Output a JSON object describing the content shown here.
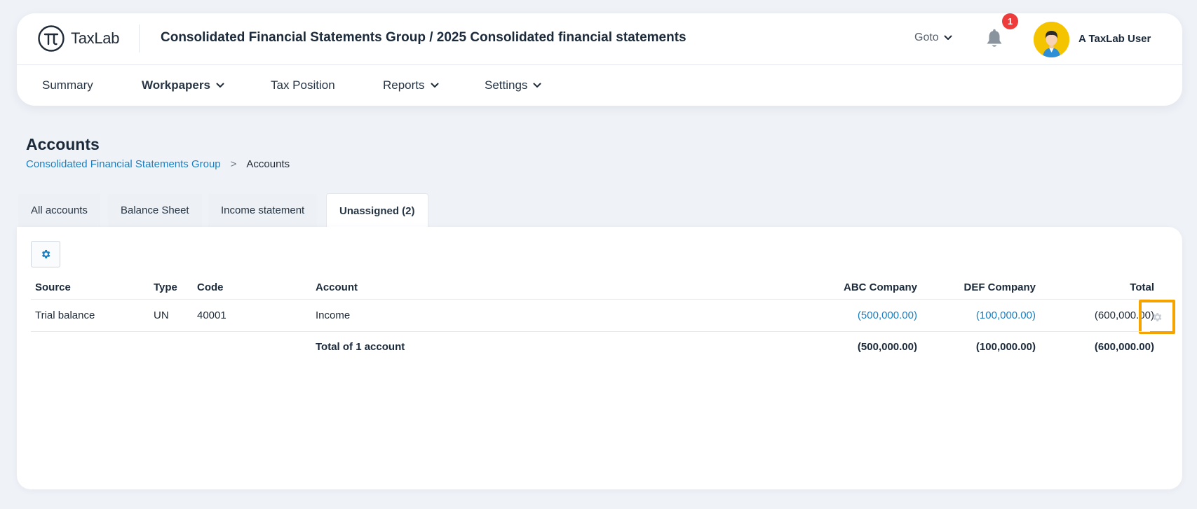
{
  "app": {
    "logo_text": "TaxLab",
    "heading": "Consolidated Financial Statements Group / 2025 Consolidated financial statements",
    "goto_label": "Goto",
    "notification_count": "1",
    "user_name": "A TaxLab User"
  },
  "nav": {
    "summary": "Summary",
    "workpapers": "Workpapers",
    "tax_position": "Tax Position",
    "reports": "Reports",
    "settings": "Settings"
  },
  "page": {
    "title": "Accounts",
    "breadcrumb_parent": "Consolidated Financial Statements Group",
    "breadcrumb_sep": ">",
    "breadcrumb_current": "Accounts"
  },
  "tabs": [
    {
      "label": "All accounts"
    },
    {
      "label": "Balance Sheet"
    },
    {
      "label": "Income statement"
    },
    {
      "label": "Unassigned (2)"
    }
  ],
  "table": {
    "headers": {
      "source": "Source",
      "type": "Type",
      "code": "Code",
      "account": "Account",
      "abc": "ABC Company",
      "def": "DEF Company",
      "total": "Total"
    },
    "rows": [
      {
        "source": "Trial balance",
        "type": "UN",
        "code": "40001",
        "account": "Income",
        "abc": "(500,000.00)",
        "def": "(100,000.00)",
        "total": "(600,000.00)"
      }
    ],
    "footer": {
      "label": "Total of 1 account",
      "abc": "(500,000.00)",
      "def": "(100,000.00)",
      "total": "(600,000.00)"
    }
  },
  "colors": {
    "accent": "#1a7fc1",
    "highlight": "#f5a300",
    "badge": "#ee3b3b",
    "avatar_bg": "#f5c400"
  }
}
